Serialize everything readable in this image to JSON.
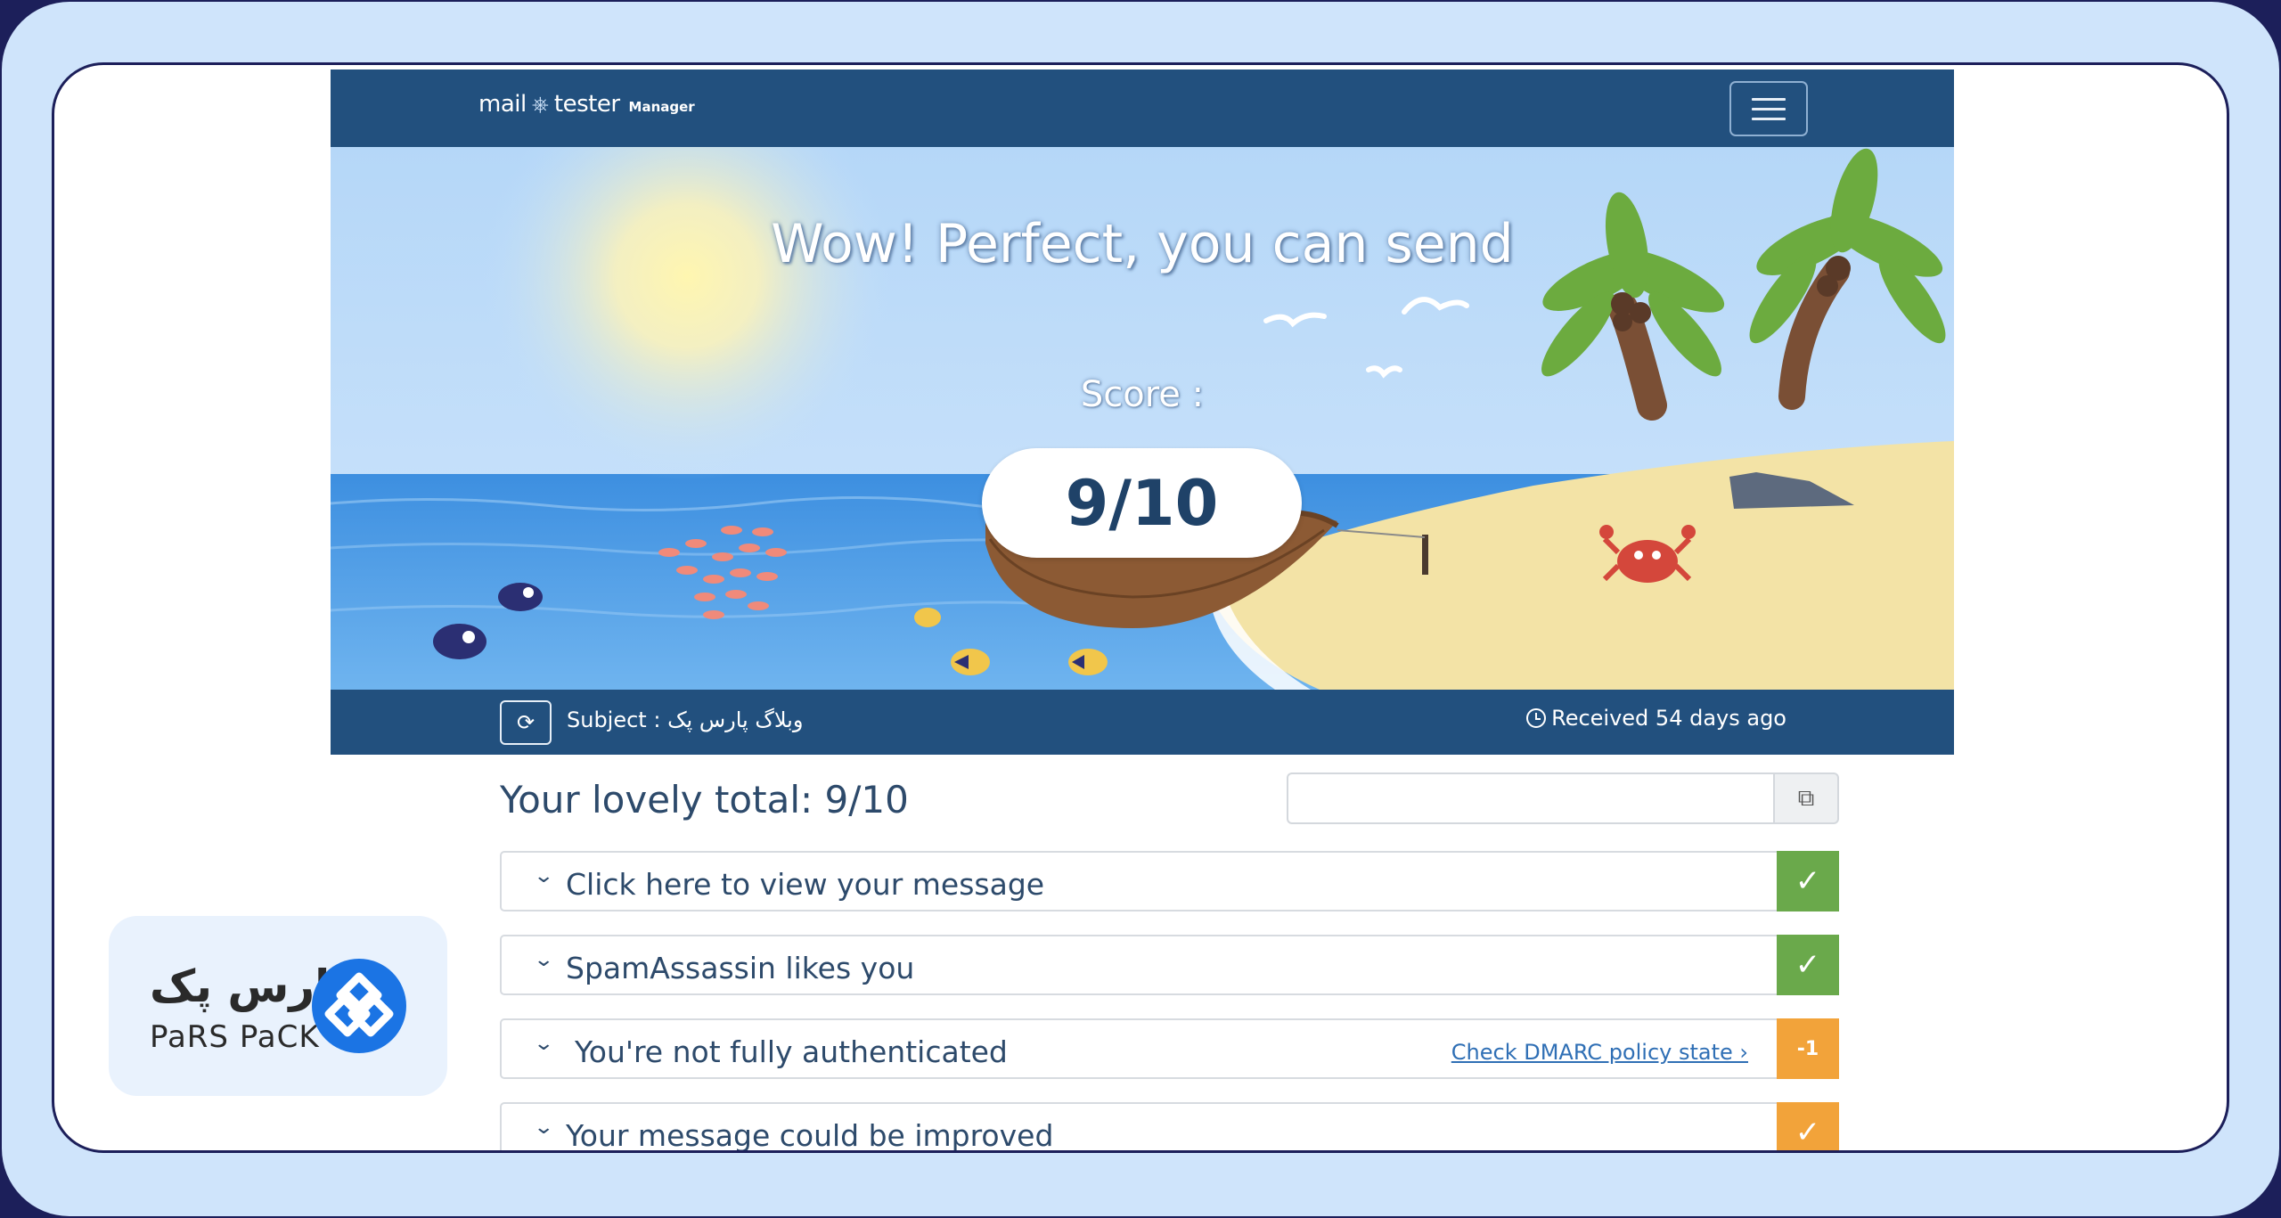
{
  "app": {
    "brand_main": "mail",
    "brand_second": "tester",
    "brand_sub": "Manager",
    "menu_icon": "hamburger-icon"
  },
  "hero": {
    "title": "Wow! Perfect, you can send",
    "score_label": "Score :",
    "score_value": "9/10"
  },
  "subject_bar": {
    "refresh_icon": "refresh-icon",
    "subject": "Subject : وبلاگ پارس پک",
    "received": "Received 54 days ago",
    "clock_icon": "clock-icon"
  },
  "summary": {
    "total": "Your lovely total: 9/10",
    "share_value": "",
    "copy_icon": "copy-icon"
  },
  "results": [
    {
      "label": "Click here to view your message",
      "link": "",
      "badge": "✓",
      "status": "pass"
    },
    {
      "label": "SpamAssassin likes you",
      "link": "",
      "badge": "✓",
      "status": "pass"
    },
    {
      "label": "You're not fully authenticated",
      "link": "Check DMARC policy state ›",
      "badge": "-1",
      "status": "warning"
    },
    {
      "label": "Your message could be improved",
      "link": "",
      "badge": "✓",
      "status": "warning"
    }
  ],
  "watermark": {
    "persian": "پارس پک",
    "latin": "PaRS PaCK"
  },
  "colors": {
    "frame": "#cfe4fb",
    "navbar": "#22507e",
    "pass": "#6aa94b",
    "warning": "#f2a33a",
    "heading": "#2d4a6b"
  }
}
